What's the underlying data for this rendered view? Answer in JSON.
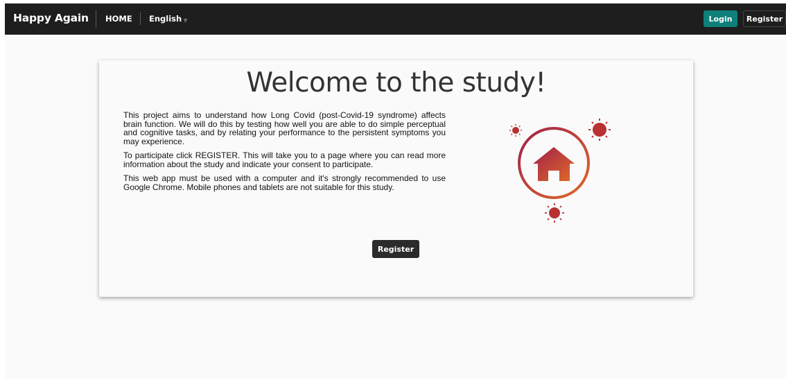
{
  "navbar": {
    "brand": "Happy Again",
    "home": "HOME",
    "language": "English",
    "language_caret": "▿",
    "login": "Login",
    "register": "Register"
  },
  "main": {
    "title": "Welcome to the study!",
    "paragraphs": [
      "This project aims to understand how Long Covid (post-Covid-19 syndrome) affects brain function. We will do this by testing how well you are able to do simple perceptual and cognitive tasks, and by relating your performance to the persistent symptoms you may experience.",
      "To participate click REGISTER. This will take you to a page where you can read more information about the study and indicate your consent to participate.",
      "This web app must be used with a computer and it's strongly recommended to use Google Chrome. Mobile phones and tablets are not suitable for this study."
    ],
    "register_button": "Register",
    "illustration_icons": [
      "house-icon",
      "virus-icon"
    ]
  },
  "colors": {
    "navbar_bg": "#1e1e1e",
    "login_bg": "#0f7f7a",
    "gradient_start": "#a0204a",
    "gradient_end": "#e06a2a",
    "virus": "#b83232"
  }
}
